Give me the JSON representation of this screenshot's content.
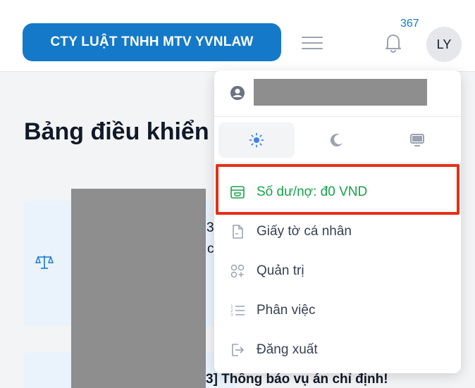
{
  "header": {
    "brand_label": "CTY LUẬT TNHH MTV YVNLAW",
    "notification_count": "367",
    "avatar_initials": "LY"
  },
  "page": {
    "title": "Bảng điều khiển",
    "peek_digit": "3",
    "peek_char": "c",
    "bottom_notice": "3] Thông báo vụ án chỉ định!"
  },
  "dropdown": {
    "menu": [
      {
        "label": "Số dư/nợ: đ0 VND",
        "icon": "wallet-icon"
      },
      {
        "label": "Giấy tờ cá nhân",
        "icon": "document-icon"
      },
      {
        "label": "Quản trị",
        "icon": "admin-icon"
      },
      {
        "label": "Phân việc",
        "icon": "list-numbered-icon"
      },
      {
        "label": "Đăng xuất",
        "icon": "logout-icon"
      }
    ]
  },
  "colors": {
    "brand": "#1479c9",
    "balance_text": "#16a34a",
    "highlight_border": "#e53017",
    "theme_sun": "#3b82f6"
  }
}
